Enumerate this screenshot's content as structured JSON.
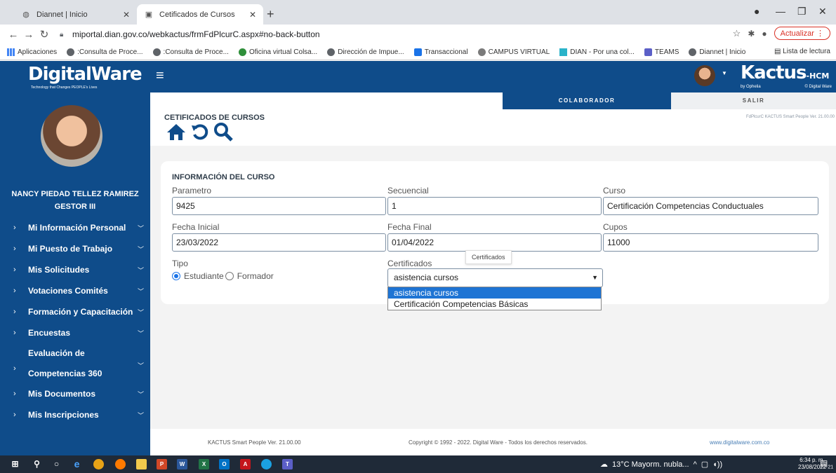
{
  "browser": {
    "tabs": [
      {
        "title": "Diannet | Inicio",
        "active": false
      },
      {
        "title": "Cetificados de Cursos",
        "active": true
      }
    ],
    "new_tab": "+",
    "url": "miportal.dian.gov.co/webkactus/frmFdPlcurC.aspx#no-back-button",
    "update_label": "Actualizar",
    "bookmarks": [
      "Aplicaciones",
      ":Consulta de Proce...",
      ":Consulta de Proce...",
      "Oficina virtual Colsa...",
      "Dirección de Impue...",
      "Transaccional",
      "CAMPUS VIRTUAL",
      "DIAN - Por una col...",
      "TEAMS",
      "Diannet | Inicio"
    ],
    "reading_list": "Lista de lectura"
  },
  "header": {
    "brand": "DigitalWare",
    "brand_tagline": "Technology that Changes PEOPLE's Lives",
    "product": "Kactus",
    "product_suffix": "-HCM",
    "product_by": "by Ophelia",
    "product_vendor": "© Digital Ware"
  },
  "sidebar": {
    "user_name": "NANCY PIEDAD TELLEZ RAMIREZ",
    "user_role": "GESTOR III",
    "items": [
      "Mi Información Personal",
      "Mi Puesto de Trabajo",
      "Mis Solicitudes",
      "Votaciones Comités",
      "Formación y Capacitación",
      "Encuestas",
      "Evaluación de Competencias 360",
      "Mis Documentos",
      "Mis Inscripciones"
    ]
  },
  "topnav": {
    "colaborador": "COLABORADOR",
    "salir": "SALIR",
    "version_small": "FdPlcurC KACTUS Smart People Ver. 21.00.00"
  },
  "page": {
    "title": "CETIFICADOS DE CURSOS"
  },
  "form": {
    "section_title": "INFORMACIÓN DEL CURSO",
    "parametro_label": "Parametro",
    "parametro_value": "9425",
    "secuencial_label": "Secuencial",
    "secuencial_value": "1",
    "curso_label": "Curso",
    "curso_value": "Certificación Competencias Conductuales",
    "fecha_inicial_label": "Fecha Inicial",
    "fecha_inicial_value": "23/03/2022",
    "fecha_final_label": "Fecha Final",
    "fecha_final_value": "01/04/2022",
    "cupos_label": "Cupos",
    "cupos_value": "11000",
    "tipo_label": "Tipo",
    "tipo_options": [
      "Estudiante",
      "Formador"
    ],
    "tipo_selected": "Estudiante",
    "certificados_label": "Certificados",
    "certificados_value": "asistencia cursos",
    "certificados_tooltip": "Certificados",
    "certificados_options": [
      "asistencia cursos",
      "Certificación Competencias Básicas"
    ]
  },
  "footer": {
    "version": "KACTUS Smart People Ver. 21.00.00",
    "copyright": "Copyright © 1992 - 2022. Digital Ware - Todos los derechos reservados.",
    "website": "www.digitalware.com.co"
  },
  "taskbar": {
    "weather": "13°C  Mayorm. nubla...",
    "time": "6:34 p. m.",
    "date": "23/08/2022",
    "notifications": "21"
  },
  "colors": {
    "primary": "#0f4c8a",
    "selection": "#1e74d4",
    "update_red": "#d93025"
  }
}
